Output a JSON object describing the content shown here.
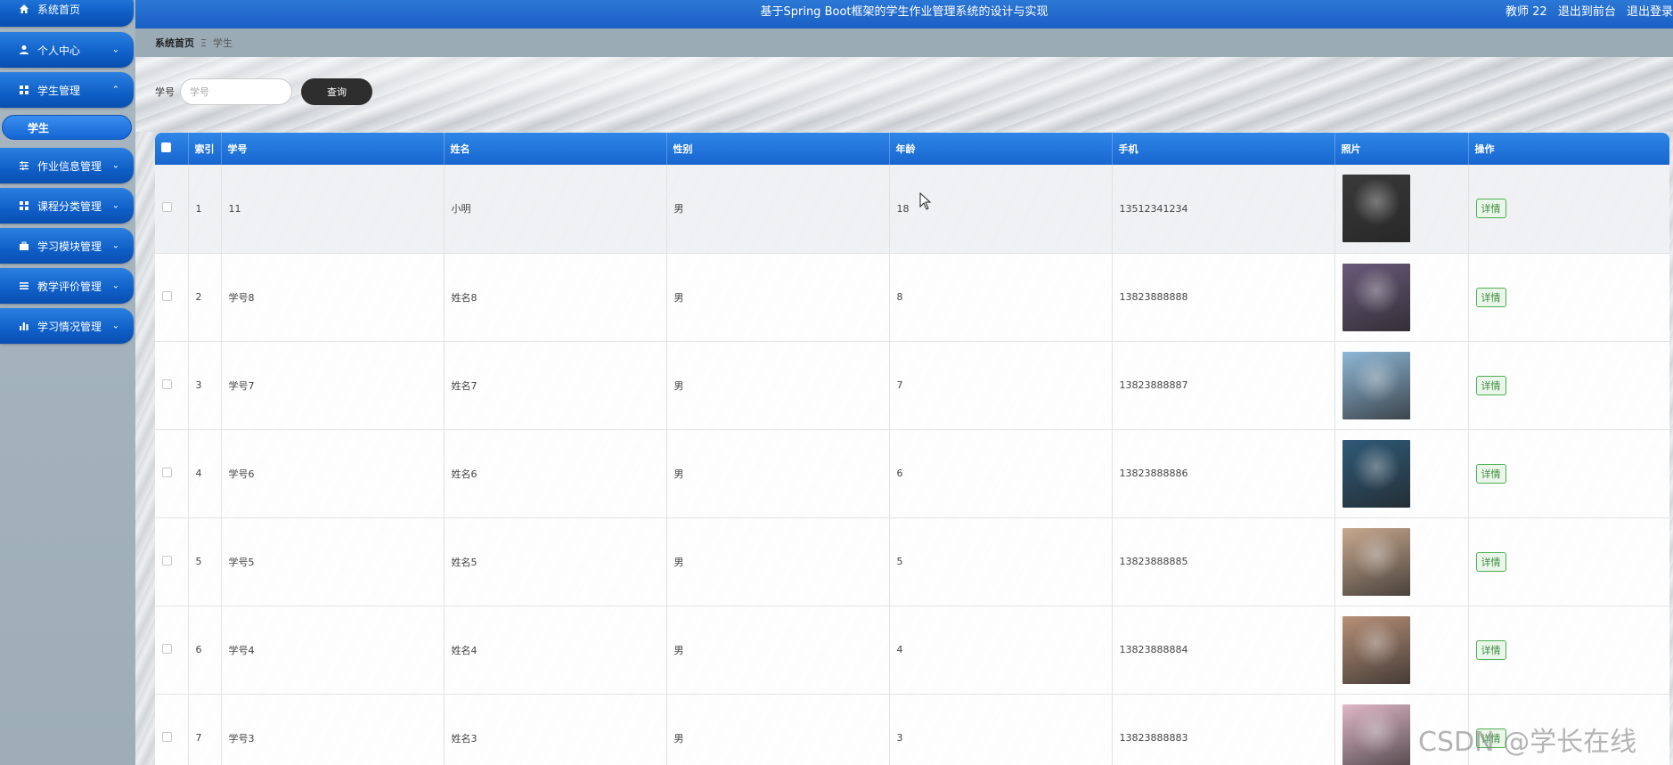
{
  "header": {
    "title": "基于Spring Boot框架的学生作业管理系统的设计与实现",
    "user": "教师 22",
    "front_link": "退出到前台",
    "logout_link": "退出登录"
  },
  "sidebar": {
    "items": [
      {
        "label": "系统首页",
        "icon": "home-icon"
      },
      {
        "label": "个人中心",
        "icon": "user-icon"
      },
      {
        "label": "学生管理",
        "icon": "grid-icon"
      },
      {
        "label": "作业信息管理",
        "icon": "sliders-icon"
      },
      {
        "label": "课程分类管理",
        "icon": "grid-icon"
      },
      {
        "label": "学习模块管理",
        "icon": "briefcase-icon"
      },
      {
        "label": "教学评价管理",
        "icon": "list-icon"
      },
      {
        "label": "学习情况管理",
        "icon": "bar-chart-icon"
      }
    ],
    "submenu_label": "学生"
  },
  "breadcrumb": {
    "home": "系统首页",
    "separator": "Ξ",
    "current": "学生"
  },
  "search": {
    "label": "学号",
    "placeholder": "学号",
    "button": "查询"
  },
  "table": {
    "columns": [
      "索引",
      "学号",
      "姓名",
      "性别",
      "年龄",
      "手机",
      "照片",
      "操作"
    ],
    "rows": [
      {
        "index": "1",
        "student_no": "11",
        "name": "小明",
        "gender": "男",
        "age": "18",
        "phone": "13512341234",
        "photo_color": "#3a3a3a",
        "action": "详情"
      },
      {
        "index": "2",
        "student_no": "学号8",
        "name": "姓名8",
        "gender": "男",
        "age": "8",
        "phone": "13823888888",
        "photo_color": "#6a5a7a",
        "action": "详情"
      },
      {
        "index": "3",
        "student_no": "学号7",
        "name": "姓名7",
        "gender": "男",
        "age": "7",
        "phone": "13823888887",
        "photo_color": "#8fb8d8",
        "action": "详情"
      },
      {
        "index": "4",
        "student_no": "学号6",
        "name": "姓名6",
        "gender": "男",
        "age": "6",
        "phone": "13823888886",
        "photo_color": "#2e5a78",
        "action": "详情"
      },
      {
        "index": "5",
        "student_no": "学号5",
        "name": "姓名5",
        "gender": "男",
        "age": "5",
        "phone": "13823888885",
        "photo_color": "#c9a98f",
        "action": "详情"
      },
      {
        "index": "6",
        "student_no": "学号4",
        "name": "姓名4",
        "gender": "男",
        "age": "4",
        "phone": "13823888884",
        "photo_color": "#b89078",
        "action": "详情"
      },
      {
        "index": "7",
        "student_no": "学号3",
        "name": "姓名3",
        "gender": "男",
        "age": "3",
        "phone": "13823888883",
        "photo_color": "#e0b8c8",
        "action": "详情"
      }
    ]
  },
  "watermark": "CSDN @学长在线",
  "colors": {
    "primary": "#1766cf",
    "search_button": "#2e2e2e",
    "detail_button": "#4caf50"
  }
}
